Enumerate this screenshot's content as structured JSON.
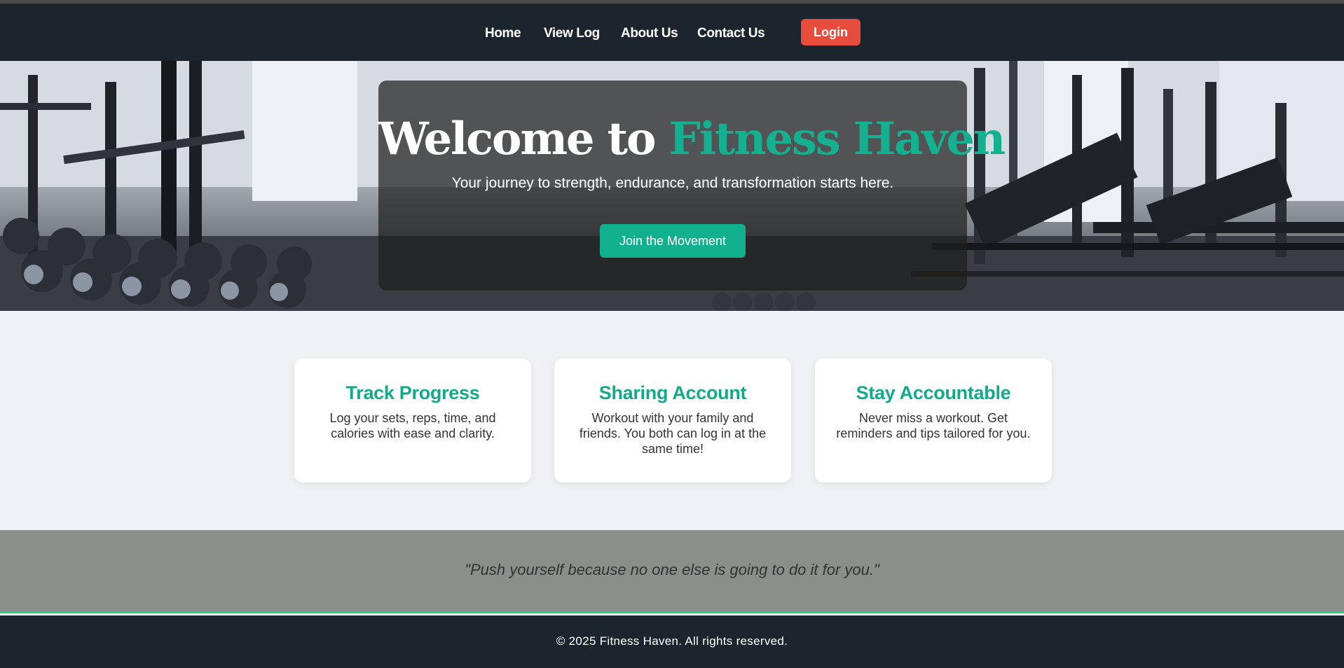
{
  "nav": {
    "links": [
      {
        "label": "Home"
      },
      {
        "label": "View Log"
      },
      {
        "label": "About Us"
      },
      {
        "label": "Contact Us"
      }
    ],
    "login_label": "Login"
  },
  "hero": {
    "title_prefix": "Welcome to ",
    "title_brand": "Fitness Haven",
    "subtitle": "Your journey to strength, endurance, and transformation starts here.",
    "cta_label": "Join the Movement"
  },
  "features": [
    {
      "title": "Track Progress",
      "text": "Log your sets, reps, time, and calories with ease and clarity."
    },
    {
      "title": "Sharing Account",
      "text": "Workout with your family and friends. You both can log in at the same time!"
    },
    {
      "title": "Stay Accountable",
      "text": "Never miss a workout. Get reminders and tips tailored for you."
    }
  ],
  "quote": "\"Push yourself because no one else is going to do it for you.\"",
  "footer": "© 2025 Fitness Haven. All rights reserved.",
  "colors": {
    "brand": "#14b08f",
    "nav_bg": "#1c252e",
    "login": "#e74c3c",
    "quote_band": "#8a8f8b",
    "accent_line": "#2ecc71"
  }
}
